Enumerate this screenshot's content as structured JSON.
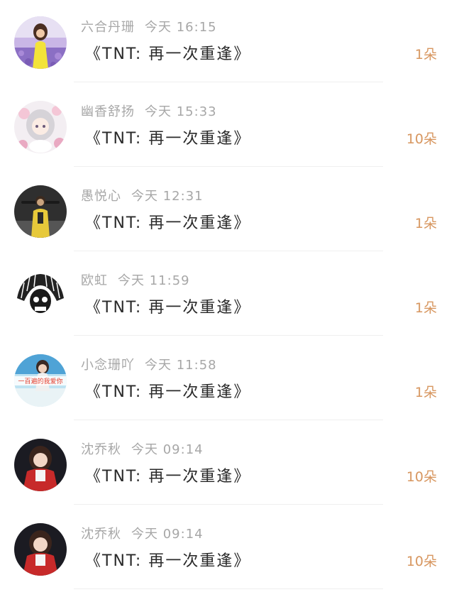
{
  "records": [
    {
      "name": "六合丹珊",
      "time": "今天 16:15",
      "gift": "《TNT: 再一次重逢》",
      "count": "1朵",
      "avatar_icon": "girl-in-flower-field-avatar"
    },
    {
      "name": "幽香舒扬",
      "time": "今天 15:33",
      "gift": "《TNT: 再一次重逢》",
      "count": "10朵",
      "avatar_icon": "anime-girl-flowers-avatar"
    },
    {
      "name": "愚悦心",
      "time": "今天 12:31",
      "gift": "《TNT: 再一次重逢》",
      "count": "1朵",
      "avatar_icon": "game-soldier-avatar"
    },
    {
      "name": "欧虹",
      "time": "今天 11:59",
      "gift": "《TNT: 再一次重逢》",
      "count": "1朵",
      "avatar_icon": "feather-skull-avatar"
    },
    {
      "name": "小念珊吖",
      "time": "今天 11:58",
      "gift": "《TNT: 再一次重逢》",
      "count": "1朵",
      "avatar_icon": "girl-beach-avatar",
      "avatar_caption": "一百遍的我爱你"
    },
    {
      "name": "沈乔秋",
      "time": "今天 09:14",
      "gift": "《TNT: 再一次重逢》",
      "count": "10朵",
      "avatar_icon": "girl-red-jacket-avatar"
    },
    {
      "name": "沈乔秋",
      "time": "今天 09:14",
      "gift": "《TNT: 再一次重逢》",
      "count": "10朵",
      "avatar_icon": "girl-red-jacket-avatar"
    }
  ],
  "colors": {
    "count_accent": "#d7965f",
    "meta_text": "#a7a7a7",
    "gift_text": "#2a2a2a"
  }
}
